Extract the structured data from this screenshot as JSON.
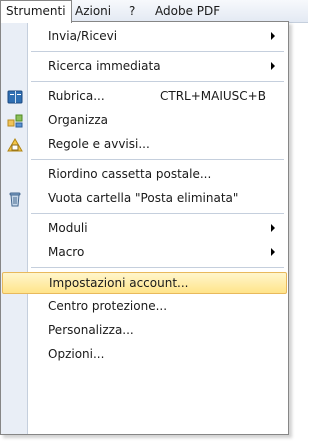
{
  "menubar": {
    "items": [
      {
        "label": "Strumenti"
      },
      {
        "label": "Azioni"
      },
      {
        "label": "?"
      },
      {
        "label": "Adobe PDF"
      }
    ]
  },
  "menu": {
    "items": [
      {
        "label": "Invia/Ricevi",
        "submenu": true
      },
      {
        "label": "Ricerca immediata",
        "submenu": true
      },
      {
        "label": "Rubrica...",
        "shortcut": "CTRL+MAIUSC+B",
        "icon": "address-book-icon"
      },
      {
        "label": "Organizza",
        "icon": "organize-icon"
      },
      {
        "label": "Regole e avvisi...",
        "icon": "rules-icon"
      },
      {
        "label": "Riordino cassetta postale..."
      },
      {
        "label": "Vuota cartella \"Posta eliminata\"",
        "icon": "trash-icon"
      },
      {
        "label": "Moduli",
        "submenu": true
      },
      {
        "label": "Macro",
        "submenu": true
      },
      {
        "label": "Impostazioni account...",
        "highlighted": true
      },
      {
        "label": "Centro protezione..."
      },
      {
        "label": "Personalizza..."
      },
      {
        "label": "Opzioni..."
      }
    ]
  },
  "colors": {
    "highlight": "#ffe48a",
    "gutter": "#e9eef6",
    "border": "#868686"
  }
}
